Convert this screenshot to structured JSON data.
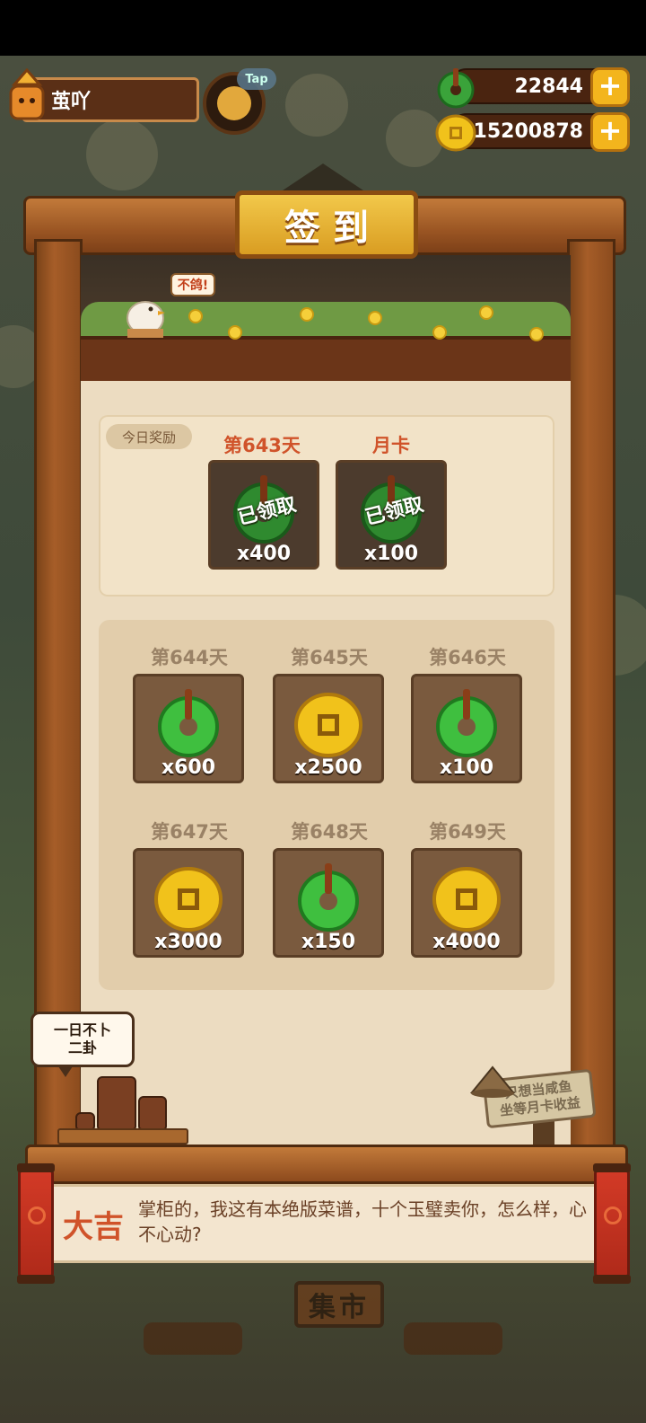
{
  "top_bar": {
    "player_name": "茧吖",
    "tap_badge": "Tap",
    "jade_amount": "22844",
    "coin_amount": "15200878",
    "plus_symbol": "+"
  },
  "board": {
    "title": "签到",
    "chicken_bubble": "不鸽!"
  },
  "today": {
    "chip_label": "今日奖励",
    "rewards": [
      {
        "label": "第643天",
        "item": "jade",
        "amount": "x400",
        "status": "已领取"
      },
      {
        "label": "月卡",
        "item": "jade",
        "amount": "x100",
        "status": "已领取"
      }
    ]
  },
  "upcoming": [
    {
      "label": "第644天",
      "item": "jade",
      "amount": "x600"
    },
    {
      "label": "第645天",
      "item": "coin",
      "amount": "x2500"
    },
    {
      "label": "第646天",
      "item": "jade",
      "amount": "x100"
    },
    {
      "label": "第647天",
      "item": "coin",
      "amount": "x3000"
    },
    {
      "label": "第648天",
      "item": "jade",
      "amount": "x150"
    },
    {
      "label": "第649天",
      "item": "coin",
      "amount": "x4000"
    }
  ],
  "decor": {
    "speech_bubble": "一日不卜\n二卦",
    "signpost_text": "只想当咸鱼\n坐等月卡收益"
  },
  "fortune": {
    "word": "大吉",
    "text": "掌柜的，我这有本绝版菜谱，十个玉璧卖你，怎么样，心不心动?"
  },
  "background": {
    "market_sign": "集市"
  },
  "colors": {
    "jade": "#3aa33a",
    "coin": "#f1c21b",
    "accent_red": "#d0532a"
  }
}
